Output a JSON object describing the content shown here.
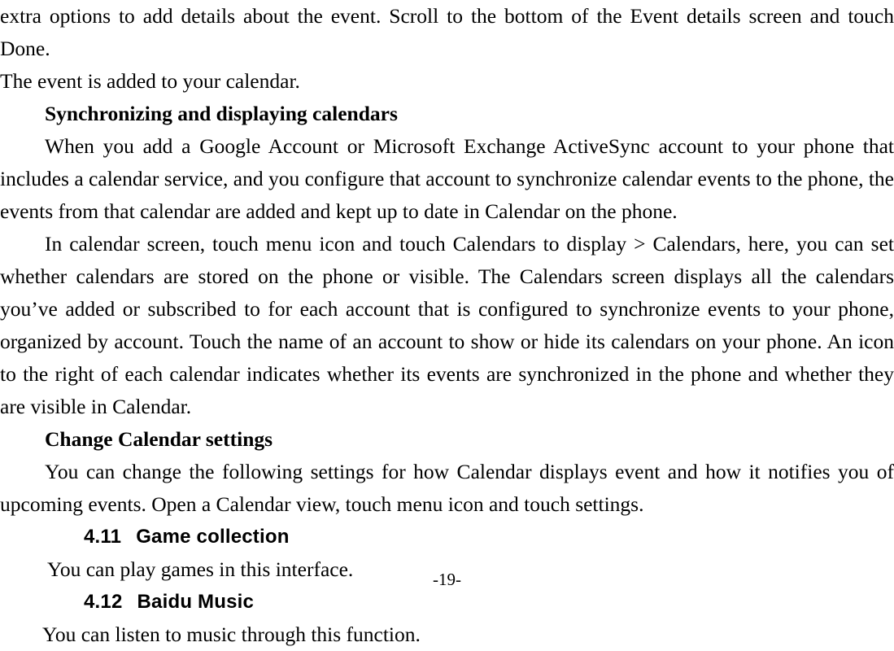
{
  "document": {
    "page_number_label": "-19-",
    "paragraphs": {
      "p_intro_continuation": "extra options to add details about the event. Scroll to the bottom of the Event details screen and touch Done.",
      "p_event_added": "The event is added to your calendar.",
      "heading_sync": "Synchronizing and displaying calendars",
      "p_sync_accounts": "When you add a Google Account or Microsoft Exchange ActiveSync account to your phone that includes a calendar service, and you configure that account to synchronize calendar events to the phone, the events from that calendar are added and kept up to date in Calendar on the phone.",
      "p_calendar_screen": "In calendar screen, touch menu icon and touch Calendars to display > Calendars, here, you can set whether calendars are stored on the phone or visible. The Calendars screen displays all the calendars you’ve added or subscribed to for each account that is configured to synchronize events to your phone, organized by account. Touch the name of an account to show or hide its calendars on your phone. An icon to the right of each calendar indicates whether its events are synchronized in the phone and whether they are visible in Calendar.",
      "heading_change_settings": "Change Calendar settings",
      "p_change_settings": "You can change the following settings for how Calendar displays event and how it notifies you of upcoming events. Open a Calendar view, touch menu icon and touch settings.",
      "p_game_body": "You can play games in this interface.",
      "p_music_body": "You can listen to music through this function."
    },
    "sections": [
      {
        "number": "4.11",
        "title": "Game collection"
      },
      {
        "number": "4.12",
        "title": "Baidu Music"
      }
    ]
  }
}
